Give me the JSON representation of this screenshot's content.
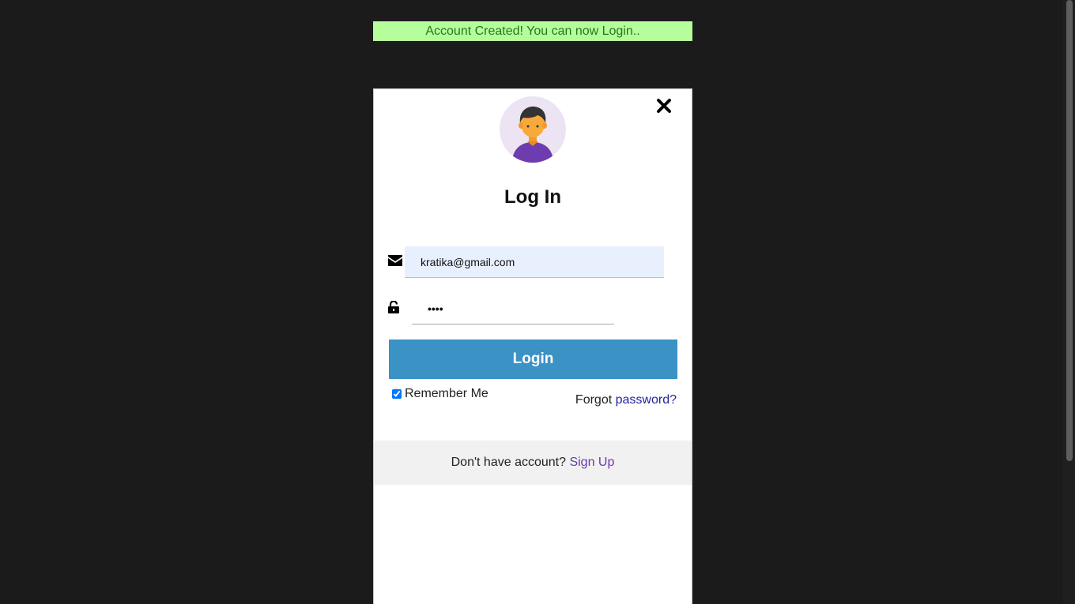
{
  "alert": {
    "message": "Account Created! You can now Login.."
  },
  "modal": {
    "title": "Log In",
    "close_icon": "close-icon",
    "avatar_icon": "user-avatar",
    "email": {
      "icon": "envelope-icon",
      "value": "kratika@gmail.com"
    },
    "password": {
      "icon": "unlock-icon",
      "value": "1234"
    },
    "login_label": "Login",
    "remember": {
      "label": "Remember Me",
      "checked": true
    },
    "forgot": {
      "prefix": "Forgot",
      "link": "password?"
    },
    "signup": {
      "prefix": "Don't have account?",
      "link": "Sign Up"
    }
  },
  "colors": {
    "background": "#1b1b1b",
    "alert_bg": "#b6fd9b",
    "alert_text": "#217b15",
    "login_button": "#3a92c5",
    "email_bg": "#e8f0fe",
    "signup_link": "#6a3aa7",
    "forgot_link": "#24249d"
  }
}
